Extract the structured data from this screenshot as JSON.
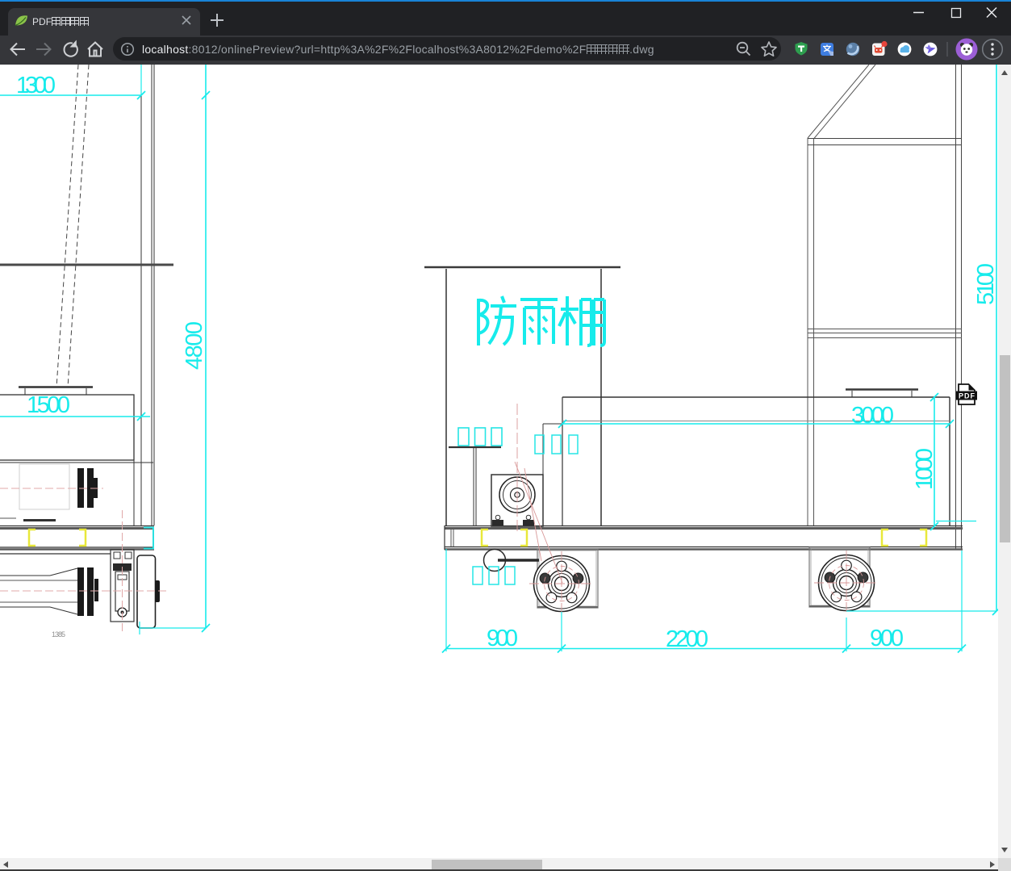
{
  "browser": {
    "tab": {
      "title": "PDF图片预览"
    },
    "new_tab_button": "+",
    "address": {
      "host": "localhost",
      "rest": ":8012/onlinePreview?url=http%3A%2F%2Flocalhost%3A8012%2Fdemo%2F养生台车.dwg"
    },
    "icons": [
      "back",
      "forward",
      "reload",
      "home",
      "page-info",
      "zoom-out",
      "bookmark-star",
      "extension-shield",
      "extension-translate",
      "extension-orbit",
      "extension-robot",
      "extension-cloud",
      "extension-bird",
      "profile-avatar",
      "browser-menu",
      "minimize",
      "maximize",
      "close"
    ]
  },
  "drawing": {
    "shelter_label": "防雨棚",
    "pdf_badge": "PDF",
    "dims": {
      "top_left": "1300",
      "left_height": "4800",
      "left_width": "1500",
      "small": "1385",
      "right_height": "5100",
      "container_width": "3000",
      "container_height": "1000",
      "bottom_left": "900",
      "bottom_center": "2200",
      "bottom_right": "900"
    }
  }
}
